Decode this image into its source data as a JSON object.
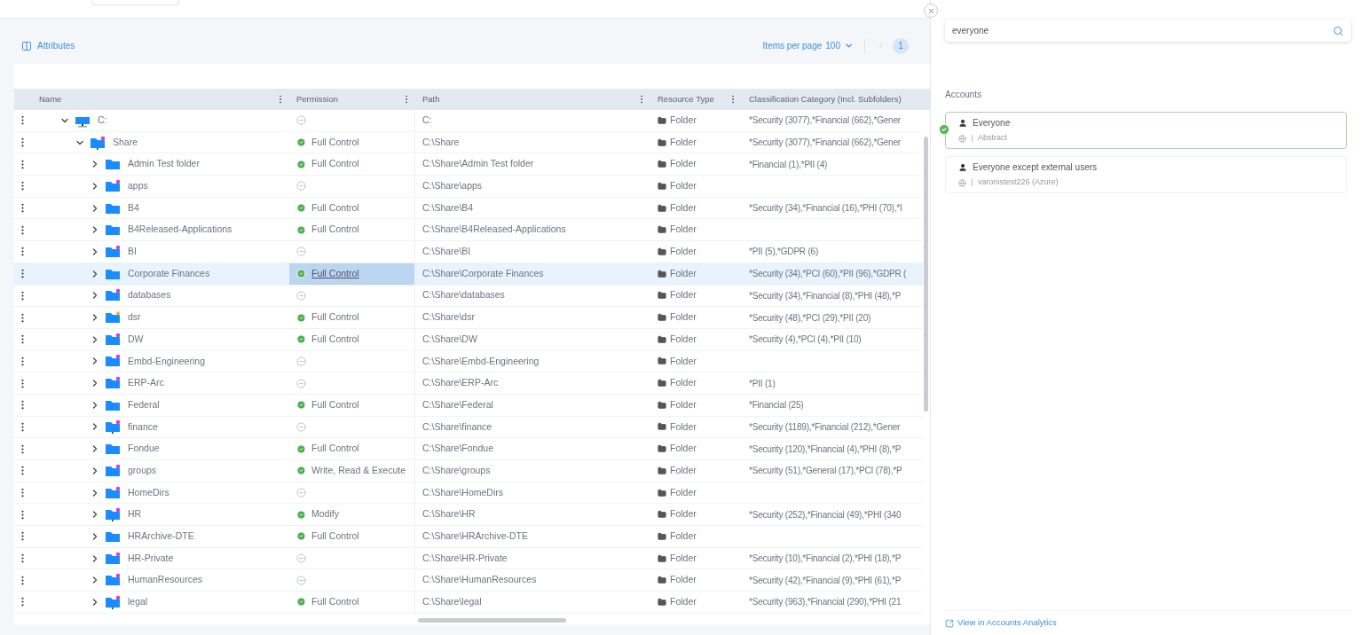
{
  "toolbar": {
    "attributes_link": "Attributes",
    "items_per_page_label": "Items per page",
    "items_per_page": "100",
    "pages": [
      {
        "label": "1",
        "selected": true
      }
    ]
  },
  "table": {
    "columns": [
      "Name",
      "Permission",
      "Path",
      "Resource Type",
      "Classification Category (Incl. Subfolders)"
    ],
    "rows": [
      {
        "name": "C:",
        "kind": "drive",
        "expanded": true,
        "selected": false,
        "granted": false,
        "path": "C:",
        "type": "Folder",
        "classification": "*Security (3077),*Financial (662),*Gener",
        "children": [
          {
            "name": "Share",
            "kind": "net-dot",
            "expanded": true,
            "selected": false,
            "granted": true,
            "permission": "Full Control",
            "path": "C:\\Share",
            "type": "Folder",
            "classification": "*Security (3077),*Financial (662),*Gener",
            "children": [
              {
                "name": "Admin Test folder",
                "kind": "plain",
                "expanded": false,
                "selected": false,
                "granted": true,
                "permission": "Full Control",
                "path": "C:\\Share\\Admin Test folder",
                "type": "Folder",
                "classification": "*Financial (1),*PII (4)"
              },
              {
                "name": "apps",
                "kind": "dot",
                "expanded": false,
                "selected": false,
                "granted": false,
                "path": "C:\\Share\\apps",
                "type": "Folder"
              },
              {
                "name": "B4",
                "kind": "plain",
                "expanded": false,
                "selected": false,
                "granted": true,
                "permission": "Full Control",
                "path": "C:\\Share\\B4",
                "type": "Folder",
                "classification": "*Security (34),*Financial (16),*PHI (70),*I"
              },
              {
                "name": "B4Released-Applications",
                "kind": "plain",
                "expanded": false,
                "selected": false,
                "granted": true,
                "permission": "Full Control",
                "path": "C:\\Share\\B4Released-Applications",
                "type": "Folder"
              },
              {
                "name": "BI",
                "kind": "dot",
                "expanded": false,
                "selected": false,
                "granted": false,
                "path": "C:\\Share\\BI",
                "type": "Folder",
                "classification": "*PII (5),*GDPR (6)"
              },
              {
                "name": "Corporate Finances",
                "kind": "plain",
                "expanded": false,
                "selected": true,
                "granted": true,
                "permission": "Full Control",
                "path": "C:\\Share\\Corporate Finances",
                "type": "Folder",
                "classification": "*Security (34),*PCI (60),*PII (96),*GDPR ("
              },
              {
                "name": "databases",
                "kind": "dot",
                "expanded": false,
                "selected": false,
                "granted": false,
                "path": "C:\\Share\\databases",
                "type": "Folder",
                "classification": "*Security (34),*Financial (8),*PHI (48),*P"
              },
              {
                "name": "dsr",
                "kind": "star",
                "expanded": false,
                "selected": false,
                "granted": true,
                "permission": "Full Control",
                "path": "C:\\Share\\dsr",
                "type": "Folder",
                "classification": "*Security (48),*PCI (29),*PII (20)"
              },
              {
                "name": "DW",
                "kind": "dot",
                "expanded": false,
                "selected": false,
                "granted": true,
                "permission": "Full Control",
                "path": "C:\\Share\\DW",
                "type": "Folder",
                "classification": "*Security (4),*PCI (4),*PII (10)"
              },
              {
                "name": "Embd-Engineering",
                "kind": "dot",
                "expanded": false,
                "selected": false,
                "granted": false,
                "path": "C:\\Share\\Embd-Engineering",
                "type": "Folder"
              },
              {
                "name": "ERP-Arc",
                "kind": "dot",
                "expanded": false,
                "selected": false,
                "granted": false,
                "path": "C:\\Share\\ERP-Arc",
                "type": "Folder",
                "classification": "*PII (1)"
              },
              {
                "name": "Federal",
                "kind": "plain",
                "expanded": false,
                "selected": false,
                "granted": true,
                "permission": "Full Control",
                "path": "C:\\Share\\Federal",
                "type": "Folder",
                "classification": "*Financial (25)"
              },
              {
                "name": "finance",
                "kind": "net-dot",
                "expanded": false,
                "selected": false,
                "granted": false,
                "path": "C:\\Share\\finance",
                "type": "Folder",
                "classification": "*Security (1189),*Financial (212),*Gener"
              },
              {
                "name": "Fondue",
                "kind": "plain",
                "expanded": false,
                "selected": false,
                "granted": true,
                "permission": "Full Control",
                "path": "C:\\Share\\Fondue",
                "type": "Folder",
                "classification": "*Security (120),*Financial (4),*PHI (8),*P"
              },
              {
                "name": "groups",
                "kind": "dot",
                "expanded": false,
                "selected": false,
                "granted": true,
                "permission": "Write, Read & Execute",
                "path": "C:\\Share\\groups",
                "type": "Folder",
                "classification": "*Security (51),*General (17),*PCI (78),*P"
              },
              {
                "name": "HomeDirs",
                "kind": "dot",
                "expanded": false,
                "selected": false,
                "granted": false,
                "path": "C:\\Share\\HomeDirs",
                "type": "Folder"
              },
              {
                "name": "HR",
                "kind": "net-dot",
                "expanded": false,
                "selected": false,
                "granted": true,
                "permission": "Modify",
                "path": "C:\\Share\\HR",
                "type": "Folder",
                "classification": "*Security (252),*Financial (49),*PHI (340"
              },
              {
                "name": "HRArchive-DTE",
                "kind": "plain",
                "expanded": false,
                "selected": false,
                "granted": true,
                "permission": "Full Control",
                "path": "C:\\Share\\HRArchive-DTE",
                "type": "Folder"
              },
              {
                "name": "HR-Private",
                "kind": "dot",
                "expanded": false,
                "selected": false,
                "granted": false,
                "path": "C:\\Share\\HR-Private",
                "type": "Folder",
                "classification": "*Security (10),*Financial (2),*PHI (18),*P"
              },
              {
                "name": "HumanResources",
                "kind": "dot",
                "expanded": false,
                "selected": false,
                "granted": false,
                "path": "C:\\Share\\HumanResources",
                "type": "Folder",
                "classification": "*Security (42),*Financial (9),*PHI (61),*P"
              },
              {
                "name": "legal",
                "kind": "net-dot",
                "expanded": false,
                "selected": false,
                "granted": true,
                "permission": "Full Control",
                "path": "C:\\Share\\legal",
                "type": "Folder",
                "classification": "*Security (963),*Financial (290),*PHI (21"
              }
            ]
          }
        ]
      }
    ]
  },
  "panel": {
    "search": {
      "value": "everyone"
    },
    "section_title": "Accounts",
    "accounts": [
      {
        "name": "Everyone",
        "domain": "Abstract",
        "selected": true
      },
      {
        "name": "Everyone except external users",
        "domain": "varonistest226 (Azure)",
        "selected": false
      }
    ],
    "footer_link": "View in Accounts Analytics"
  }
}
